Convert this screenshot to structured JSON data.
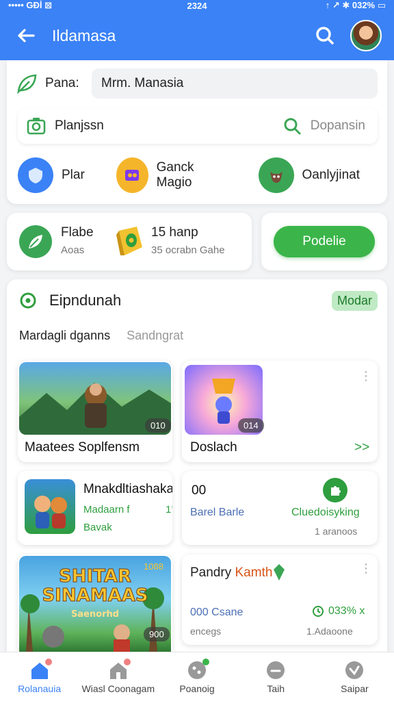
{
  "status": {
    "left": "••••• GĐİ ⊠",
    "time": "2324",
    "right": "↑ ↗ ✱ 032% ▭"
  },
  "header": {
    "title": "Ildamasa"
  },
  "top": {
    "name_label": "Pana:",
    "name_value": "Mrm. Manasia",
    "place_label": "Planjssn",
    "place_action": "Dopansin"
  },
  "categories": [
    {
      "label": "Plar",
      "color": "#3b82f6",
      "icon": "shield-icon"
    },
    {
      "label": "Ganck Magio",
      "color": "#f5b52a",
      "icon": "gem-icon"
    },
    {
      "label": "Oanlyjinat",
      "color": "#3aa655",
      "icon": "creature-icon"
    }
  ],
  "promo": {
    "title": "Flabe",
    "subtitle": "Aoas",
    "amount": "15 hanp",
    "detail": "35 ocrabn Gahe",
    "button": "Podelie"
  },
  "section": {
    "title": "Eipndunah",
    "badge": "Modar",
    "tab_active": "Mardagli dganns",
    "tab_other": "Sandngrat"
  },
  "tiles": {
    "t1": {
      "title": "Maatees Soplfensm",
      "pill": "010"
    },
    "t2": {
      "title": "Doslach",
      "pill": "014",
      "arrow": ">>"
    },
    "t3": {
      "title": "Mnakdltiashaka",
      "line1": "Madaarn f",
      "line1_right": "1’",
      "line2": "Bavak"
    },
    "t4": {
      "title": "00",
      "sub": "Barel Barle",
      "right": "Cluedoisyking",
      "meta": "1 aranoos"
    },
    "t5": {
      "banner_line1": "SHITAR",
      "banner_line2": "SINAMAAS",
      "banner_line3": "Saenorhd",
      "pill": "900",
      "corner": "1088"
    },
    "t6": {
      "title_a": "Pandry",
      "title_b": "Kamth",
      "sub": "000 Csane",
      "score": "033% x",
      "meta_left": "encegs",
      "meta_right": "1.Adaoone"
    }
  },
  "nav": [
    {
      "label": "Rolanauia",
      "icon": "home-icon",
      "active": true
    },
    {
      "label": "Wiasl Coonagam",
      "icon": "store-icon",
      "active": false
    },
    {
      "label": "Poanoig",
      "icon": "game-icon",
      "active": false
    },
    {
      "label": "Taih",
      "icon": "chat-icon",
      "active": false
    },
    {
      "label": "Saipar",
      "icon": "heart-icon",
      "active": false
    }
  ],
  "colors": {
    "primary": "#3b82f6",
    "accent": "#3bb54a"
  }
}
